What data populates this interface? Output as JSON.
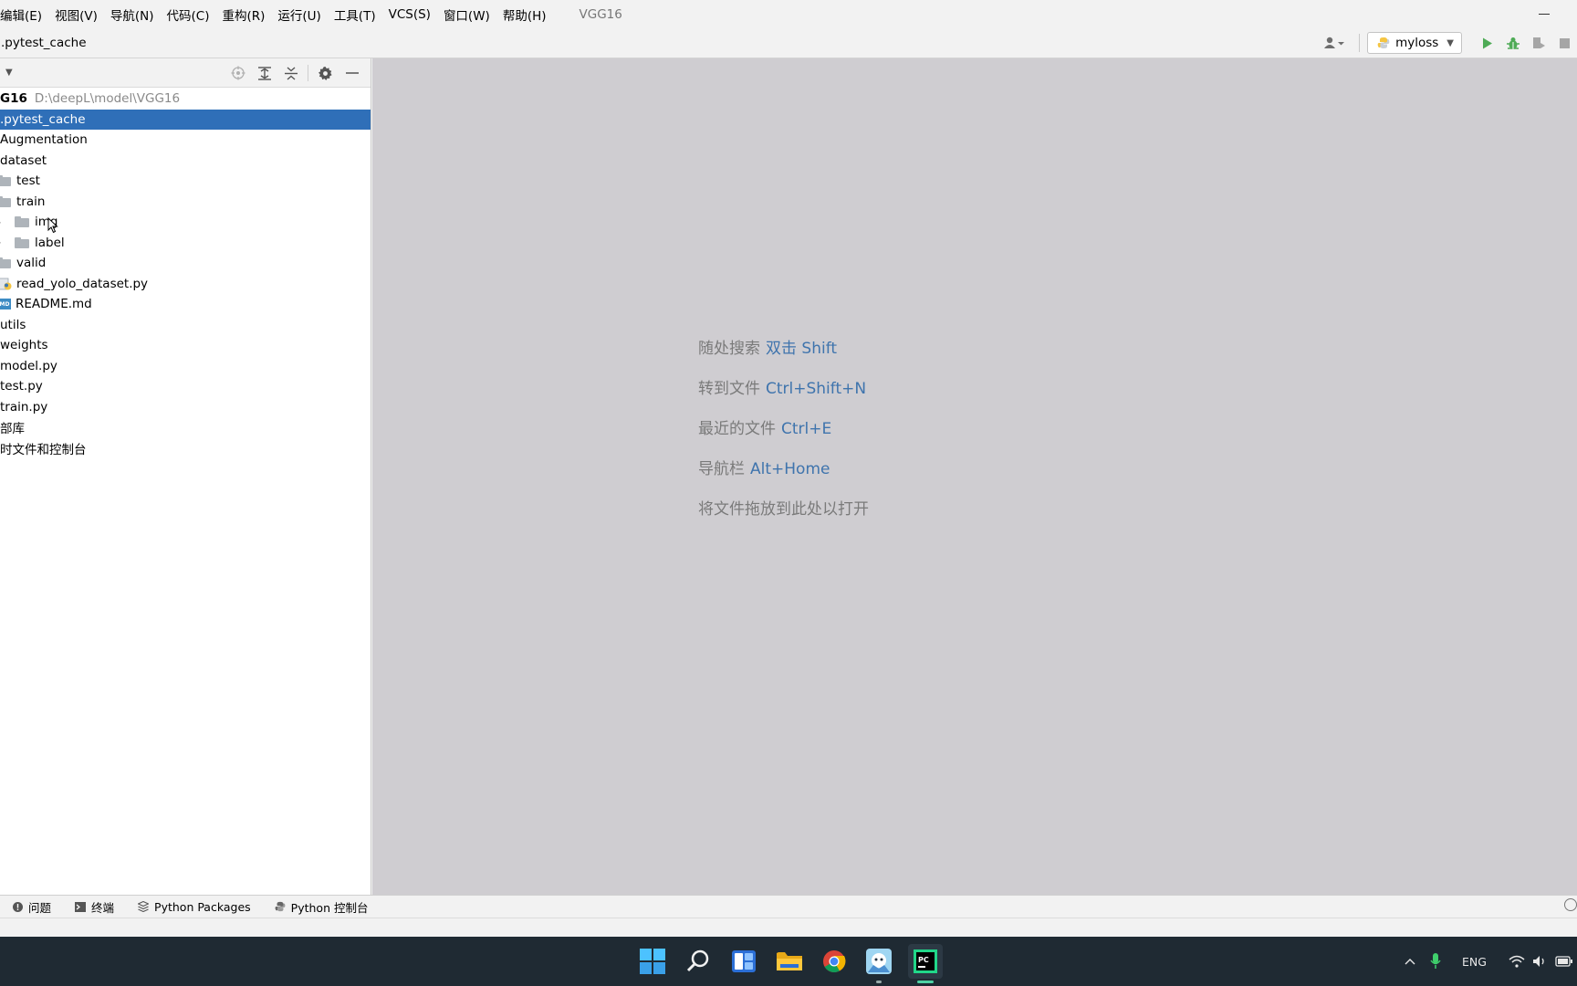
{
  "menubar": {
    "items": [
      "编辑(E)",
      "视图(V)",
      "导航(N)",
      "代码(C)",
      "重构(R)",
      "运行(U)",
      "工具(T)",
      "VCS(S)",
      "窗口(W)",
      "帮助(H)"
    ],
    "app_title": "VGG16"
  },
  "navbar": {
    "breadcrumb": ".pytest_cache",
    "run_config": "myloss"
  },
  "project": {
    "root_name": "G16",
    "root_path": "D:\\deepL\\model\\VGG16",
    "rows": [
      {
        "label": ".pytest_cache"
      },
      {
        "label": "Augmentation"
      },
      {
        "label": "dataset"
      },
      {
        "label": "test"
      },
      {
        "label": "train"
      },
      {
        "label": "img"
      },
      {
        "label": "label"
      },
      {
        "label": "valid"
      },
      {
        "label": "read_yolo_dataset.py"
      },
      {
        "label": "README.md"
      },
      {
        "label": "utils"
      },
      {
        "label": "weights"
      },
      {
        "label": "model.py"
      },
      {
        "label": "test.py"
      },
      {
        "label": "train.py"
      },
      {
        "label": "部库"
      },
      {
        "label": "时文件和控制台"
      }
    ]
  },
  "editor": {
    "hints": [
      {
        "text": "随处搜索",
        "key": "双击 Shift"
      },
      {
        "text": "转到文件",
        "key": "Ctrl+Shift+N"
      },
      {
        "text": "最近的文件",
        "key": "Ctrl+E"
      },
      {
        "text": "导航栏",
        "key": "Alt+Home"
      },
      {
        "text": "将文件拖放到此处以打开",
        "key": ""
      }
    ]
  },
  "toolstrip": {
    "tabs": [
      "问题",
      "终端",
      "Python Packages",
      "Python 控制台"
    ]
  },
  "taskbar": {
    "language": "ENG"
  }
}
